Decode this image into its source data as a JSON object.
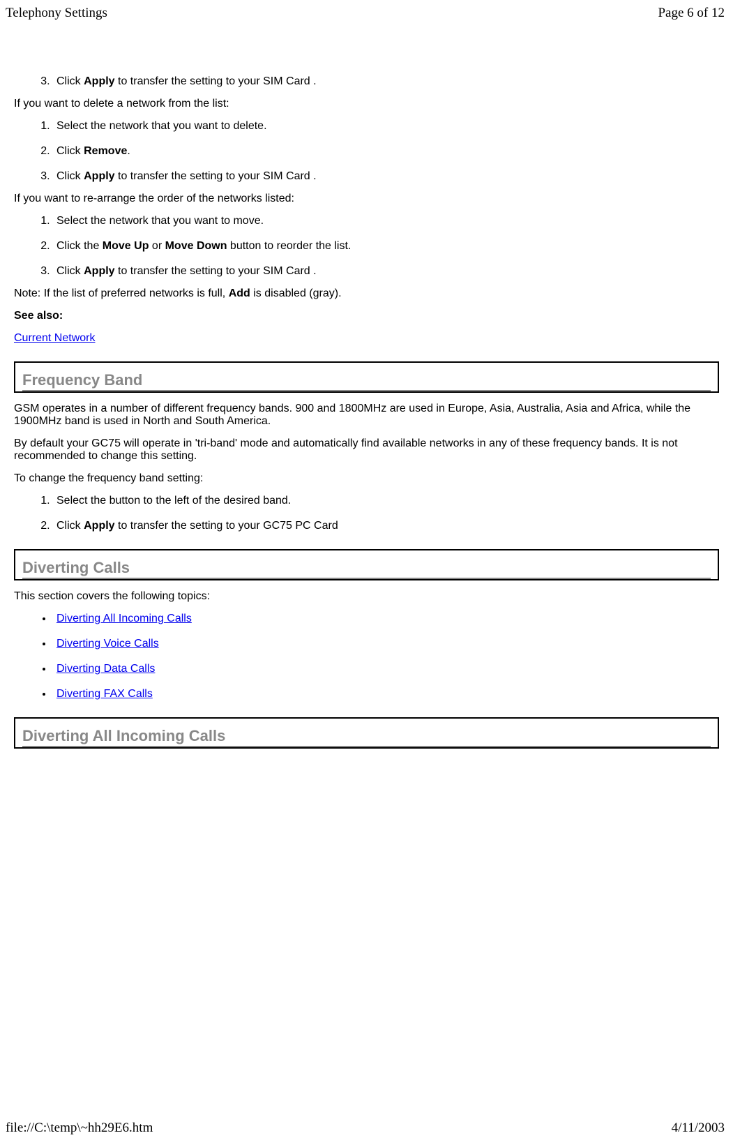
{
  "header": {
    "title": "Telephony Settings",
    "page_info": "Page 6 of 12"
  },
  "footer": {
    "path": "file://C:\\temp\\~hh29E6.htm",
    "date": "4/11/2003"
  },
  "list1": [
    {
      "num": "3.",
      "prefix": "Click ",
      "bold": "Apply",
      "suffix": " to transfer the setting to your SIM Card ."
    }
  ],
  "para1": "If you want to delete a network from the list:",
  "list2": [
    {
      "text": "Select the network that you want to delete."
    },
    {
      "prefix": "Click ",
      "bold": "Remove",
      "suffix": "."
    },
    {
      "prefix": "Click ",
      "bold": "Apply",
      "suffix": " to transfer the setting to your SIM Card ."
    }
  ],
  "para2": "If you want to re-arrange the order of the networks listed:",
  "list3": [
    {
      "text": "Select the network that you want to move."
    },
    {
      "prefix": "Click the ",
      "bold1": "Move Up",
      "mid": " or ",
      "bold2": "Move Down",
      "suffix": " button to reorder the list."
    },
    {
      "prefix": "Click ",
      "bold": "Apply",
      "suffix": " to transfer the setting to your SIM Card ."
    }
  ],
  "para3": {
    "prefix": "Note: If the list of preferred networks is full, ",
    "bold": "Add",
    "suffix": " is disabled (gray)."
  },
  "see_also_label": "See also:",
  "link1": "Current Network",
  "section1": {
    "title": "Frequency Band",
    "para1": "GSM operates in a number of different frequency bands. 900 and 1800MHz are used in Europe, Asia, Australia, Asia and Africa, while the 1900MHz band is used in North and South America.",
    "para2": "By default your GC75 will operate in 'tri-band' mode and automatically find available networks in any of these frequency bands. It is not recommended to change this setting.",
    "para3": "To change the frequency band setting:",
    "list": [
      {
        "text": "Select the button to the left of the desired band."
      },
      {
        "prefix": "Click ",
        "bold": "Apply",
        "suffix": " to transfer the setting to your GC75 PC Card"
      }
    ]
  },
  "section2": {
    "title": "Diverting Calls",
    "intro": "This section covers the following topics:",
    "links": [
      "Diverting All Incoming Calls",
      "Diverting Voice Calls",
      "Diverting Data Calls",
      "Diverting FAX Calls"
    ]
  },
  "section3": {
    "title": "Diverting All Incoming Calls"
  }
}
